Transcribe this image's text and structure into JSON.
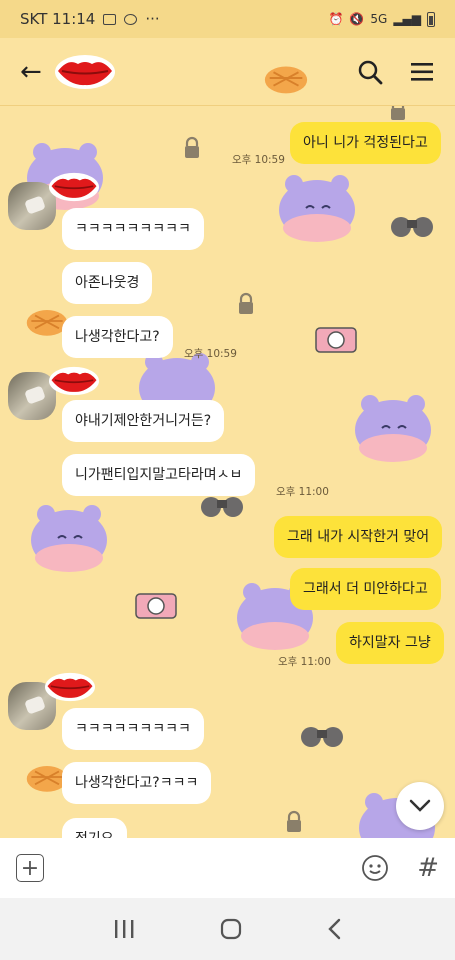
{
  "status_bar": {
    "carrier_time": "SKT 11:14",
    "dots": "···",
    "network": "5G"
  },
  "header": {
    "back_label": "←",
    "search_icon": "search-icon",
    "menu_icon": "menu-icon"
  },
  "messages": [
    {
      "text": "아니 니가 걱정된다고",
      "sender": "me",
      "time": "오후 10:59"
    },
    {
      "text": "ㅋㅋㅋㅋㅋㅋㅋㅋㅋ",
      "sender": "other"
    },
    {
      "text": "아존나웃경",
      "sender": "other"
    },
    {
      "text": "나생각한다고?",
      "sender": "other",
      "time": "오후 10:59"
    },
    {
      "text": "야내기제안한거니거든?",
      "sender": "other"
    },
    {
      "text": "니가팬티입지말고타라며ㅅㅂ",
      "sender": "other",
      "time": "오후 11:00"
    },
    {
      "text": "그래 내가 시작한거 맞어",
      "sender": "me"
    },
    {
      "text": "그래서 더 미안하다고",
      "sender": "me"
    },
    {
      "text": "하지말자 그냥",
      "sender": "me",
      "time": "오후 11:00"
    },
    {
      "text": "ㅋㅋㅋㅋㅋㅋㅋㅋㅋ",
      "sender": "other"
    },
    {
      "text": "나생각한다고?ㅋㅋㅋ",
      "sender": "other"
    },
    {
      "text": "정기요",
      "sender": "other"
    }
  ],
  "input_bar": {
    "plus_label": "+",
    "hash_label": "#"
  },
  "colors": {
    "background": "#fbe3a0",
    "my_bubble": "#fde23a",
    "other_bubble": "#ffffff"
  }
}
